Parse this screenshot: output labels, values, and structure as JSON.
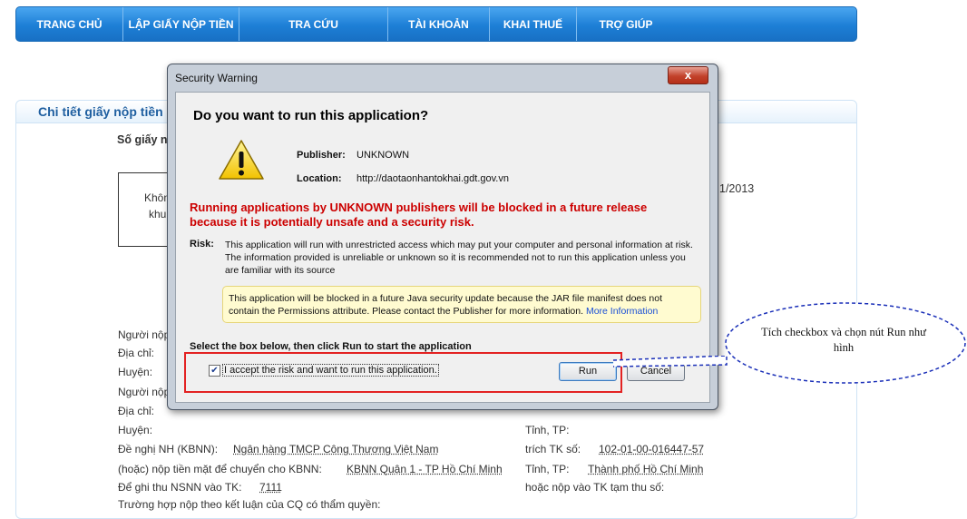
{
  "nav": {
    "items": [
      "TRANG CHỦ",
      "LẬP GIẤY NỘP TIỀN",
      "TRA CỨU",
      "TÀI KHOẢN",
      "KHAI THUẾ",
      "TRỢ GIÚP"
    ]
  },
  "page": {
    "panel_title": "Chi tiết giấy nộp tiền",
    "so_giay": "Số giấy n",
    "box_line1": "Khôn",
    "box_line2": "khu",
    "date_fragment": "1/2013",
    "rows_left": [
      "Người nộp",
      "Địa chỉ:",
      "Huyện:",
      "Người nộp",
      "Địa chỉ:",
      "Huyện:"
    ],
    "de_nghi_label": "Đề nghị NH (KBNN):",
    "de_nghi_value": "Ngân hàng TMCP Công Thương Việt Nam",
    "tien_mat_label": "(hoặc) nộp tiền mặt để chuyển cho KBNN:",
    "tien_mat_value": "KBNN Quận 1 - TP Hồ Chí Minh",
    "ghi_thu_label": "Để ghi thu NSNN vào TK:",
    "ghi_thu_value": "7111",
    "tinh_tp": "Tỉnh, TP:",
    "trich_tk_label": "trích TK số:",
    "trich_tk_value": "102-01-00-016447-57",
    "tinh_tp2": "Tỉnh, TP:",
    "tinh_tp2_value": "Thành phố Hồ Chí Minh",
    "tk_tam_thu": "hoặc nộp vào TK tạm thu số:",
    "truong_hop": "Trường hợp nộp theo kết luận của CQ có thẩm quyền:"
  },
  "dialog": {
    "title": "Security Warning",
    "close": "x",
    "heading": "Do you want to run this application?",
    "publisher_label": "Publisher:",
    "publisher_value": "UNKNOWN",
    "location_label": "Location:",
    "location_value": "http://daotaonhantokhai.gdt.gov.vn",
    "red_warning": "Running applications by UNKNOWN publishers will be blocked in a future release because it is potentially unsafe and a security risk.",
    "risk_label": "Risk:",
    "risk_text": "This application will run with unrestricted access which may put your computer and personal information at risk. The information provided is unreliable or unknown so it is recommended not to run this application unless you are familiar with its source",
    "yellow_text": "This application will be blocked in a future Java security update because the JAR file manifest does not contain the Permissions attribute. Please contact the Publisher for more information.",
    "more_info": "More Information",
    "select_text": "Select the box below, then click Run to start the application",
    "checkbox_checked": true,
    "checkbox_label": "I accept the risk and want to run this application.",
    "run_label": "Run",
    "cancel_label": "Cancel"
  },
  "callout": {
    "text": "Tích checkbox và chọn nút Run như hình"
  },
  "colors": {
    "nav": "#1d7fd6",
    "warning_red": "#cc0000",
    "highlight": "#e32222",
    "callout_border": "#1a2fb8"
  }
}
